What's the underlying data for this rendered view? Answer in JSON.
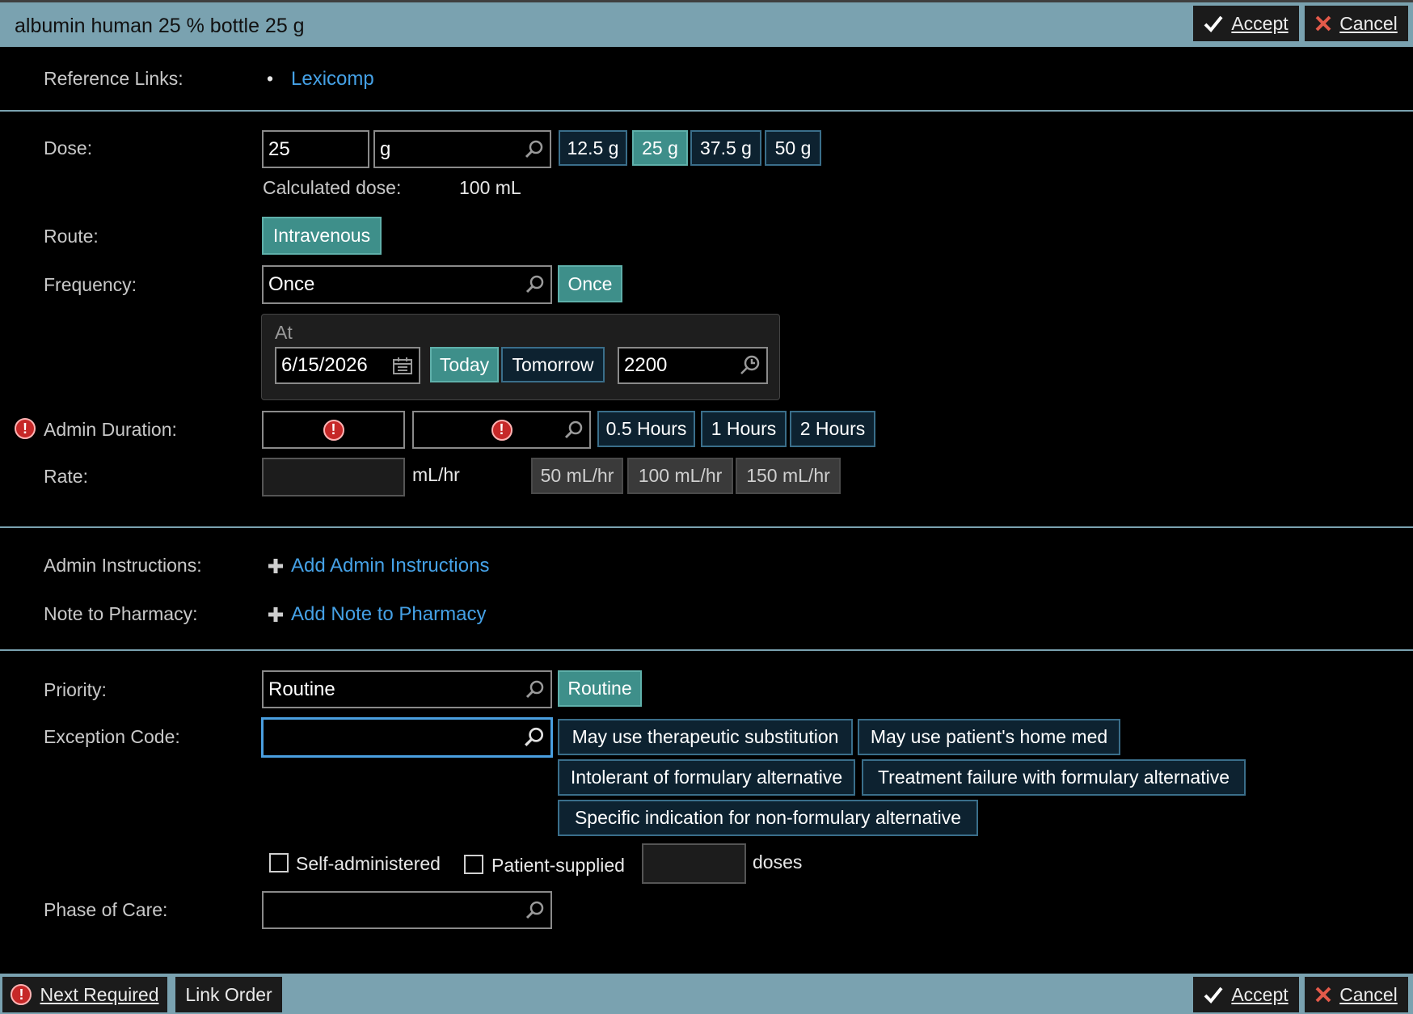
{
  "header": {
    "title": "albumin human 25 % bottle 25 g",
    "accept_label": "Accept",
    "cancel_label": "Cancel"
  },
  "reference": {
    "label": "Reference Links:",
    "bullet": "•",
    "link": "Lexicomp"
  },
  "dose": {
    "label": "Dose:",
    "value": "25",
    "unit": "g",
    "chips": [
      "12.5 g",
      "25 g",
      "37.5 g",
      "50 g"
    ],
    "selected_chip": "25 g",
    "calc_label": "Calculated dose:",
    "calc_value": "100 mL"
  },
  "route": {
    "label": "Route:",
    "chip": "Intravenous"
  },
  "frequency": {
    "label": "Frequency:",
    "value": "Once",
    "chip": "Once",
    "at_label": "At",
    "date": "6/15/2026",
    "today": "Today",
    "tomorrow": "Tomorrow",
    "time": "2200"
  },
  "admin_duration": {
    "label": "Admin Duration:",
    "chips": [
      "0.5 Hours",
      "1 Hours",
      "2 Hours"
    ]
  },
  "rate": {
    "label": "Rate:",
    "unit": "mL/hr",
    "chips": [
      "50 mL/hr",
      "100 mL/hr",
      "150 mL/hr"
    ]
  },
  "admin_instructions": {
    "label": "Admin Instructions:",
    "link": "Add Admin Instructions"
  },
  "note_pharmacy": {
    "label": "Note to Pharmacy:",
    "link": "Add Note to Pharmacy"
  },
  "priority": {
    "label": "Priority:",
    "value": "Routine",
    "chip": "Routine"
  },
  "exception": {
    "label": "Exception Code:",
    "chips": [
      "May use therapeutic substitution",
      "May use patient's home med",
      "Intolerant of formulary alternative",
      "Treatment failure with formulary alternative",
      "Specific indication for non-formulary alternative"
    ]
  },
  "options": {
    "self_administered": "Self-administered",
    "patient_supplied": "Patient-supplied",
    "doses": "doses"
  },
  "phase": {
    "label": "Phase of Care:"
  },
  "footer": {
    "next_required": "Next Required",
    "link_order": "Link Order",
    "accept_label": "Accept",
    "cancel_label": "Cancel"
  },
  "colors": {
    "bar": "#7aa2b0",
    "chip_bg": "#0d2230",
    "chip_selected": "#3e8f8a",
    "link": "#45a1e6",
    "warning": "#c62828"
  }
}
